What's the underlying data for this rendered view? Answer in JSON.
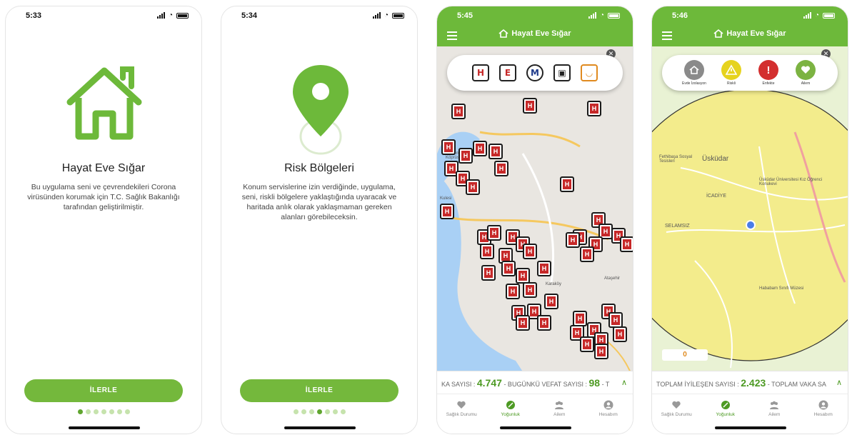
{
  "screens": [
    {
      "status": {
        "time": "5:33"
      },
      "title": "Hayat Eve Sığar",
      "body": "Bu uygulama seni ve çevrendekileri Corona virüsünden korumak için T.C. Sağlık Bakanlığı tarafından geliştirilmiştir.",
      "button": "İLERLE",
      "dots_total": 7,
      "dots_active": 1
    },
    {
      "status": {
        "time": "5:34"
      },
      "title": "Risk Bölgeleri",
      "body": "Konum servislerine izin verdiğinde, uygulama, seni, riskli bölgelere yaklaştığında uyaracak ve haritada anlık olarak yaklaşmaman gereken alanları görebileceksin.",
      "button": "İLERLE",
      "dots_total": 7,
      "dots_active": 4
    },
    {
      "status": {
        "time": "5:45"
      },
      "app_title": "Hayat Eve Sığar",
      "filters": [
        "hospital-icon",
        "pharmacy-e-icon",
        "metro-icon",
        "bus-icon",
        "market-cart-icon"
      ],
      "map_labels": [
        "15 Temmuz Şehitler Köprüsü",
        "Kulesi",
        "Karaköy",
        "Ataşehir"
      ],
      "ticker": {
        "label_a": "KA SAYISI :",
        "value_a": "4.747",
        "label_b": "- BUGÜNKÜ VEFAT SAYISI :",
        "value_b": "98",
        "tail": "- T"
      },
      "tabs": [
        "Sağlık Durumu",
        "Yoğunluk",
        "Ailem",
        "Hesabım"
      ],
      "active_tab": 1
    },
    {
      "status": {
        "time": "5:46"
      },
      "app_title": "Hayat Eve Sığar",
      "categories": [
        {
          "label": "Evde İzolasyon",
          "color": "#8a8a8a",
          "icon": "house-gear-icon"
        },
        {
          "label": "Riskli",
          "color": "#e6d31e",
          "icon": "warning-icon"
        },
        {
          "label": "Enfekte",
          "color": "#d32f2f",
          "icon": "exclamation-icon"
        },
        {
          "label": "Ailem",
          "color": "#7cb342",
          "icon": "heart-icon"
        }
      ],
      "map_labels": [
        "Üsküdar",
        "Fethibaşa Sosyal Tesisleri",
        "İCADİYE",
        "SELAMSIZ",
        "Üsküdar Üniversitesi Kız Öğrenci Konukevi",
        "Hababam Sınıfı Müzesi"
      ],
      "counter_badge": "0",
      "ticker": {
        "label_a": "TOPLAM İYİLEŞEN SAYISI :",
        "value_a": "2.423",
        "label_b": "- TOPLAM VAKA SA",
        "value_b": "",
        "tail": ""
      },
      "tabs": [
        "Sağlık Durumu",
        "Yoğunluk",
        "Ailem",
        "Hesabım"
      ],
      "active_tab": 1
    }
  ],
  "colors": {
    "brand_green": "#6db93a",
    "hospital_red": "#c62828",
    "risk_zone": "#f3ec8c"
  }
}
